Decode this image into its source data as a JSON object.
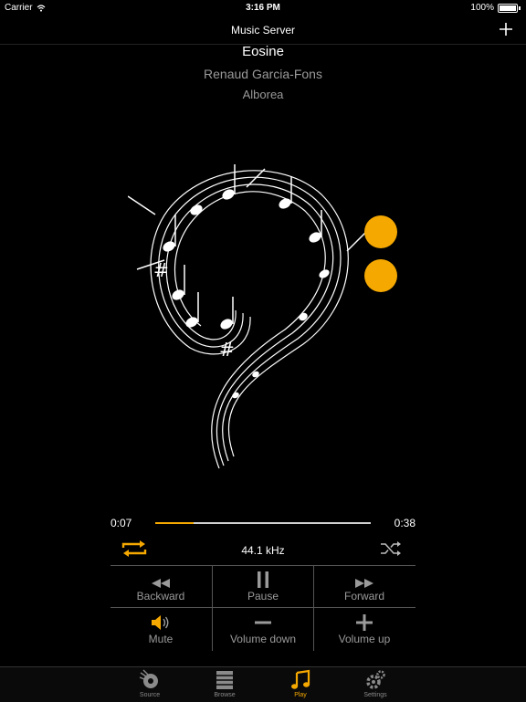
{
  "status": {
    "carrier": "Carrier",
    "time": "3:16 PM",
    "battery": "100%"
  },
  "nav": {
    "title": "Music Server",
    "add_icon": "plus-icon"
  },
  "track": {
    "title": "Eosine",
    "artist": "Renaud Garcia-Fons",
    "album": "Alborea"
  },
  "player": {
    "elapsed": "0:07",
    "total": "0:38",
    "progress_fraction": 0.18,
    "sample_rate": "44.1 kHz",
    "accent": "#f5a800"
  },
  "controls": {
    "backward": "Backward",
    "pause": "Pause",
    "forward": "Forward",
    "mute": "Mute",
    "volume_down": "Volume down",
    "volume_up": "Volume up"
  },
  "tabs": [
    {
      "label": "Source",
      "icon": "source-icon"
    },
    {
      "label": "Browse",
      "icon": "browse-icon"
    },
    {
      "label": "Play",
      "icon": "music-note-icon",
      "active": true
    },
    {
      "label": "Settings",
      "icon": "gear-icon"
    }
  ]
}
